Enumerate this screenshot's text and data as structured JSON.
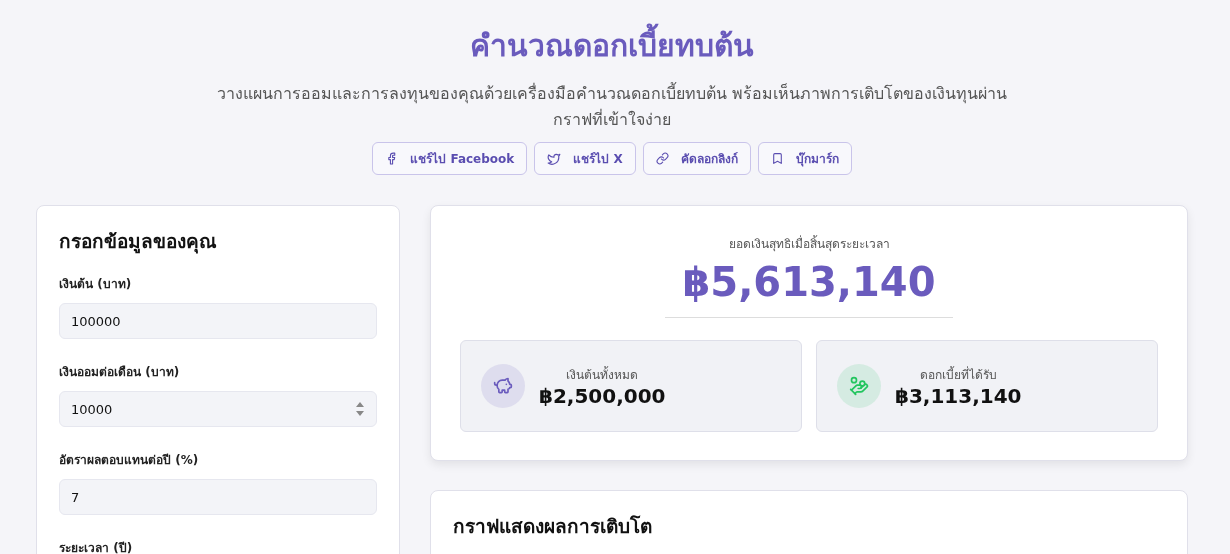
{
  "header": {
    "title": "คำนวณดอกเบี้ยทบต้น",
    "subtitle": "วางแผนการออมและการลงทุนของคุณด้วยเครื่องมือคำนวณดอกเบี้ยทบต้น พร้อมเห็นภาพการเติบโตของเงินทุนผ่านกราฟที่เข้าใจง่าย"
  },
  "share_buttons": [
    {
      "kind": "facebook",
      "label": "แชร์ไป Facebook"
    },
    {
      "kind": "x",
      "label": "แชร์ไป X"
    },
    {
      "kind": "link",
      "label": "คัดลอกลิงก์"
    },
    {
      "kind": "bookmark",
      "label": "บุ๊กมาร์ก"
    }
  ],
  "form": {
    "title": "กรอกข้อมูลของคุณ",
    "fields": [
      {
        "label": "เงินต้น (บาท)",
        "value": "100000",
        "kind": "text"
      },
      {
        "label": "เงินออมต่อเดือน (บาท)",
        "value": "10000",
        "kind": "spinner"
      },
      {
        "label": "อัตราผลตอบแทนต่อปี (%)",
        "value": "7",
        "kind": "text"
      },
      {
        "label": "ระยะเวลา (ปี)"
      }
    ]
  },
  "summary": {
    "label": "ยอดเงินสุทธิเมื่อสิ้นสุดระยะเวลา",
    "total": "฿5,613,140",
    "stats": [
      {
        "kind": "principal",
        "color": "#6a5bbd",
        "label": "เงินต้นทั้งหมด",
        "value": "฿2,500,000"
      },
      {
        "kind": "interest",
        "color": "#22c55e",
        "label": "ดอกเบี้ยที่ได้รับ",
        "value": "฿3,113,140"
      }
    ]
  },
  "chart_card": {
    "title": "กราฟแสดงผลการเติบโต"
  }
}
